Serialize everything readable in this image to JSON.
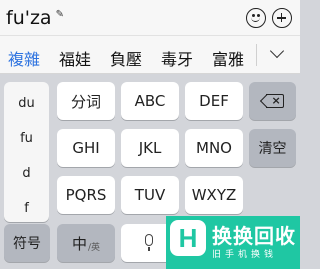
{
  "composition": {
    "text": "fu'za",
    "edit_glyph": "✎"
  },
  "toolbar": {
    "icons": [
      "emoji-icon",
      "add-icon"
    ]
  },
  "candidates": {
    "items": [
      "複雜",
      "福娃",
      "負壓",
      "毒牙",
      "富雅"
    ],
    "selected_index": 0,
    "accent_color": "#2f74e0",
    "expand_icon": "chevron-down-icon"
  },
  "pinyin_options": [
    "du",
    "fu",
    "d",
    "f"
  ],
  "keys": {
    "fenci": "分词",
    "abc": "ABC",
    "def": "DEF",
    "ghi": "GHI",
    "jkl": "JKL",
    "mno": "MNO",
    "clear": "清空",
    "pqrs": "PQRS",
    "tuv": "TUV",
    "wxyz": "WXYZ",
    "symbol": "符号",
    "zh": "中",
    "zh_sub": "/英"
  },
  "watermark": {
    "logo": "H",
    "title": "换换回收",
    "subtitle": "旧手机换钱",
    "color": "#1fc7a3"
  }
}
